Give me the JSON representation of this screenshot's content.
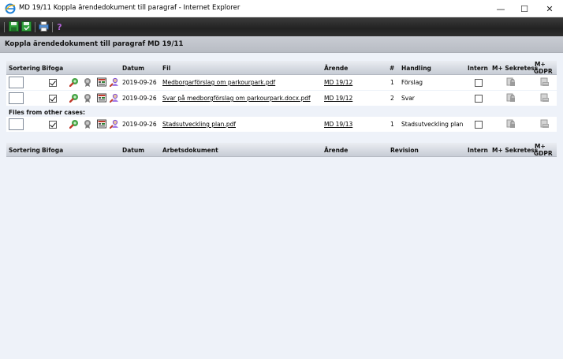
{
  "window": {
    "title": "MD 19/11 Koppla ärendedokument till paragraf - Internet Explorer",
    "minimize": "—",
    "maximize": "☐",
    "close": "✕"
  },
  "page": {
    "title": "Koppla ärendedokument till paragraf MD 19/11"
  },
  "docs_table": {
    "headers": {
      "sortering": "Sortering",
      "bifoga": "Bifoga",
      "datum": "Datum",
      "fil": "Fil",
      "arende": "Ärende",
      "nr": "#",
      "handling": "Handling",
      "intern": "Intern",
      "sekretess": "M+ Sekretess",
      "gdpr_1": "M+",
      "gdpr_2": "GDPR"
    },
    "rows": [
      {
        "datum": "2019-09-26",
        "fil": "Medborgarförslag om parkourpark.pdf",
        "arende": "MD 19/12",
        "nr": "1",
        "handling": "Förslag",
        "bifoga": true,
        "intern": false
      },
      {
        "datum": "2019-09-26",
        "fil": "Svar på medborgförslag om parkourpark.docx.pdf",
        "arende": "MD 19/12",
        "nr": "2",
        "handling": "Svar",
        "bifoga": true,
        "intern": false
      }
    ],
    "other_cases_label": "Files from other cases:",
    "other_rows": [
      {
        "datum": "2019-09-26",
        "fil": "Stadsutveckling plan.pdf",
        "arende": "MD 19/13",
        "nr": "1",
        "handling": "Stadsutveckling plan",
        "bifoga": true,
        "intern": false
      }
    ]
  },
  "work_table": {
    "headers": {
      "sortering": "Sortering",
      "bifoga": "Bifoga",
      "datum": "Datum",
      "arbetsdokument": "Arbetsdokument",
      "arende": "Ärende",
      "revision": "Revision",
      "intern": "Intern",
      "sekretess": "M+ Sekretess",
      "gdpr_1": "M+",
      "gdpr_2": "GDPR"
    }
  },
  "colors": {
    "toolbar": "#2a2a2a",
    "pagebar": "#c0c4cc",
    "content_bg": "#eef2f9",
    "header_bg": "#d3d7de"
  }
}
